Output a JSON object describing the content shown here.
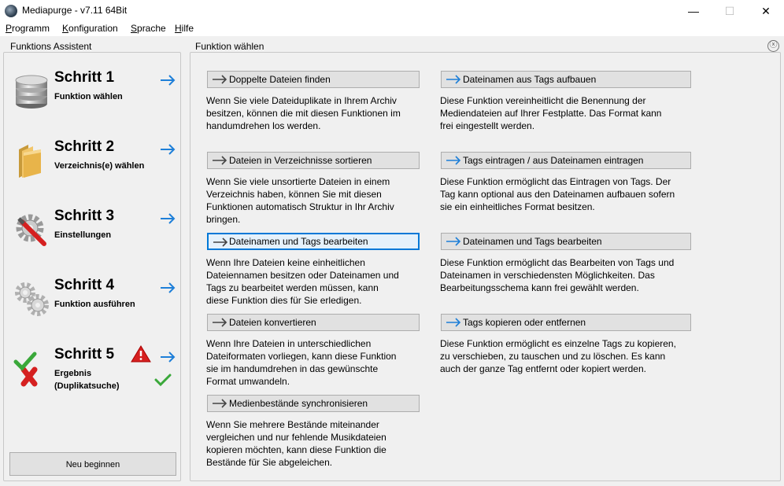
{
  "window": {
    "title": "Mediapurge - v7.11 64Bit",
    "minimize": "—",
    "maximize": "☐",
    "close": "✕"
  },
  "menu": [
    {
      "label": "Programm",
      "key": "P"
    },
    {
      "label": "Konfiguration",
      "key": "K"
    },
    {
      "label": "Sprache",
      "key": "S"
    },
    {
      "label": "Hilfe",
      "key": "H"
    }
  ],
  "left": {
    "title": "Funktions Assistent",
    "steps": [
      {
        "title": "Schritt 1",
        "sub": "Funktion wählen",
        "icon": "database-icon"
      },
      {
        "title": "Schritt 2",
        "sub": "Verzeichnis(e) wählen",
        "icon": "folder-icon"
      },
      {
        "title": "Schritt 3",
        "sub": "Einstellungen",
        "icon": "gear-wrench-icon"
      },
      {
        "title": "Schritt 4",
        "sub": "Funktion ausführen",
        "icon": "gears-icon"
      },
      {
        "title": "Schritt 5",
        "sub": "Ergebnis\n(Duplikatsuche)",
        "icon": "check-cross-icon"
      }
    ],
    "new_button": "Neu beginnen"
  },
  "right": {
    "title": "Funktion wählen",
    "close_icon": "ⓧ",
    "functions": [
      {
        "label": "Doppelte Dateien finden",
        "desc": "Wenn Sie viele Dateiduplikate in Ihrem Archiv\nbesitzen, können die mit diesen Funktionen im\nhandumdrehen los werden."
      },
      {
        "label": "Dateien in Verzeichnisse sortieren",
        "desc": "Wenn Sie viele unsortierte Dateien in einem\nVerzeichnis  haben, können Sie mit diesen\nFunktionen automatisch Struktur in Ihr Archiv\nbringen."
      },
      {
        "label": "Dateinamen und Tags bearbeiten",
        "desc": "Wenn Ihre Dateien keine einheitlichen\nDateiennamen besitzen oder Dateinamen und\nTags zu bearbeitet werden müssen, kann\ndiese Funktion dies für Sie erledigen."
      },
      {
        "label": "Dateien konvertieren",
        "desc": "Wenn Ihre Dateien in unterschiedlichen\nDateiformaten vorliegen, kann diese Funktion\nsie im handumdrehen in das gewünschte\nFormat umwandeln."
      },
      {
        "label": "Medienbestände synchronisieren",
        "desc": "Wenn Sie mehrere Bestände miteinander\nvergleichen und nur fehlende Musikdateien\nkopieren möchten, kann diese Funktion die\nBestände für Sie abgeleichen."
      },
      {
        "label": "Dateinamen aus Tags  aufbauen",
        "desc": "Diese Funktion vereinheitlicht die Benennung der\nMediendateien auf Ihrer Festplatte. Das Format kann\nfrei eingestellt werden."
      },
      {
        "label": "Tags eintragen / aus Dateinamen eintragen",
        "desc": "Diese Funktion ermöglicht das Eintragen von Tags. Der\nTag kann optional aus den Dateinamen aufbauen sofern\nsie ein einheitliches Format besitzen."
      },
      {
        "label": "Dateinamen und Tags bearbeiten",
        "desc": "Diese Funktion ermöglicht das Bearbeiten von Tags und\nDateinamen in verschiedensten Möglichkeiten. Das\nBearbeitungsschema kann frei gewählt werden."
      },
      {
        "label": "Tags kopieren oder entfernen",
        "desc": "Diese Funktion ermöglicht es einzelne Tags zu kopieren,\n zu verschieben, zu tauschen und zu löschen. Es kann\nauch der ganze Tag entfernt oder kopiert werden."
      }
    ]
  },
  "colors": {
    "accent": "#0078d7",
    "arrow_blue": "#1e7fd8",
    "warning_red": "#d62020",
    "check_green": "#3aa83a"
  }
}
